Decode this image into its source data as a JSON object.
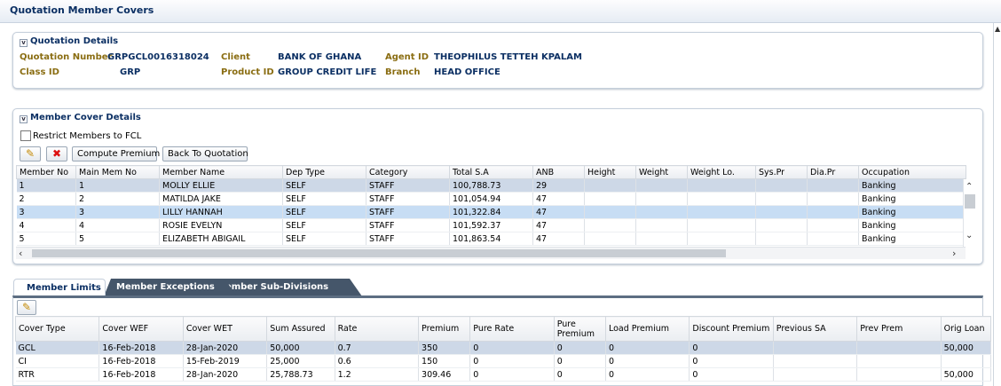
{
  "title": "Quotation Member Covers",
  "quotation": {
    "header": "Quotation Details",
    "fields": [
      {
        "label": "Quotation Number",
        "value": "GRPGCL0016318024"
      },
      {
        "label": "Client",
        "value": "BANK OF GHANA"
      },
      {
        "label": "Agent ID",
        "value": "THEOPHILUS TETTEH KPALAM"
      },
      {
        "label": "Class ID",
        "value": "GRP"
      },
      {
        "label": "Product ID",
        "value": "GROUP CREDIT LIFE"
      },
      {
        "label": "Branch",
        "value": "HEAD OFFICE"
      }
    ]
  },
  "member_cover": {
    "header": "Member Cover Details",
    "restrict_label": "Restrict Members to FCL",
    "restrict_checked": false,
    "compute_label": "Compute Premium",
    "back_label": "Back To Quotation",
    "columns": [
      "Member No",
      "Main Mem No",
      "Member Name",
      "Dep Type",
      "Category",
      "Total S.A",
      "ANB",
      "Height",
      "Weight",
      "Weight Lo.",
      "Sys.Pr",
      "Dia.Pr",
      "Occupation"
    ],
    "rows": [
      [
        "1",
        "1",
        "MOLLY ELLIE",
        "SELF",
        "STAFF",
        "100,788.73",
        "29",
        "",
        "",
        "",
        "",
        "",
        "Banking"
      ],
      [
        "2",
        "2",
        "MATILDA JAKE",
        "SELF",
        "STAFF",
        "101,054.94",
        "47",
        "",
        "",
        "",
        "",
        "",
        "Banking"
      ],
      [
        "3",
        "3",
        "LILLY HANNAH",
        "SELF",
        "STAFF",
        "101,322.84",
        "47",
        "",
        "",
        "",
        "",
        "",
        "Banking"
      ],
      [
        "4",
        "4",
        "ROSIE EVELYN",
        "SELF",
        "STAFF",
        "101,592.37",
        "47",
        "",
        "",
        "",
        "",
        "",
        "Banking"
      ],
      [
        "5",
        "5",
        "ELIZABETH ABIGAIL",
        "SELF",
        "STAFF",
        "101,863.54",
        "47",
        "",
        "",
        "",
        "",
        "",
        "Banking"
      ]
    ]
  },
  "tabs": [
    "Member Limits",
    "Member Exceptions",
    "Member Sub-Divisions"
  ],
  "limits": {
    "columns": [
      "Cover Type",
      "Cover WEF",
      "Cover WET",
      "Sum Assured",
      "Rate",
      "Premium",
      "Pure Rate",
      "Pure Premium",
      "Load Premium",
      "Discount Premium",
      "Previous SA",
      "Prev Prem",
      "Orig Loan"
    ],
    "rows": [
      [
        "GCL",
        "16-Feb-2018",
        "28-Jan-2020",
        "50,000",
        "0.7",
        "350",
        "0",
        "0",
        "0",
        "0",
        "",
        "",
        "50,000"
      ],
      [
        "CI",
        "16-Feb-2018",
        "15-Feb-2019",
        "25,000",
        "0.6",
        "150",
        "0",
        "0",
        "0",
        "0",
        "",
        "",
        ""
      ],
      [
        "RTR",
        "16-Feb-2018",
        "28-Jan-2020",
        "25,788.73",
        "1.2",
        "309.46",
        "0",
        "0",
        "0",
        "0",
        "",
        "",
        "50,000"
      ]
    ]
  },
  "icons": {
    "toggle": "collapse-icon",
    "edit": "edit-pencil-icon",
    "delete": "delete-x-icon"
  }
}
